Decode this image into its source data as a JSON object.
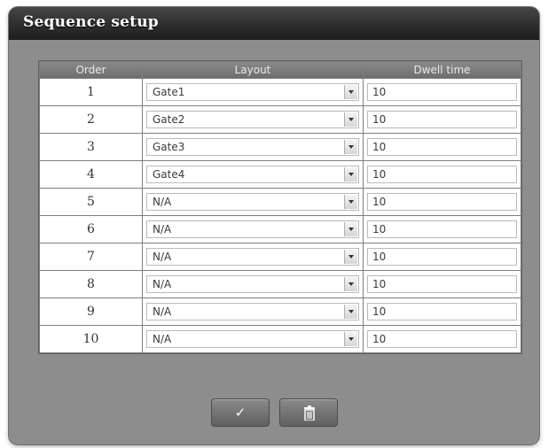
{
  "dialog": {
    "title": "Sequence setup"
  },
  "table": {
    "headers": {
      "order": "Order",
      "layout": "Layout",
      "dwell": "Dwell time"
    },
    "rows": [
      {
        "order": "1",
        "layout": "Gate1",
        "dwell": "10"
      },
      {
        "order": "2",
        "layout": "Gate2",
        "dwell": "10"
      },
      {
        "order": "3",
        "layout": "Gate3",
        "dwell": "10"
      },
      {
        "order": "4",
        "layout": "Gate4",
        "dwell": "10"
      },
      {
        "order": "5",
        "layout": "N/A",
        "dwell": "10"
      },
      {
        "order": "6",
        "layout": "N/A",
        "dwell": "10"
      },
      {
        "order": "7",
        "layout": "N/A",
        "dwell": "10"
      },
      {
        "order": "8",
        "layout": "N/A",
        "dwell": "10"
      },
      {
        "order": "9",
        "layout": "N/A",
        "dwell": "10"
      },
      {
        "order": "10",
        "layout": "N/A",
        "dwell": "10"
      }
    ]
  },
  "buttons": {
    "confirm_icon": "checkmark-icon",
    "confirm_glyph": "✓",
    "delete_icon": "trash-icon"
  },
  "colors": {
    "panel": "#8d8d8d",
    "titlebar": "#2e2e2e"
  }
}
